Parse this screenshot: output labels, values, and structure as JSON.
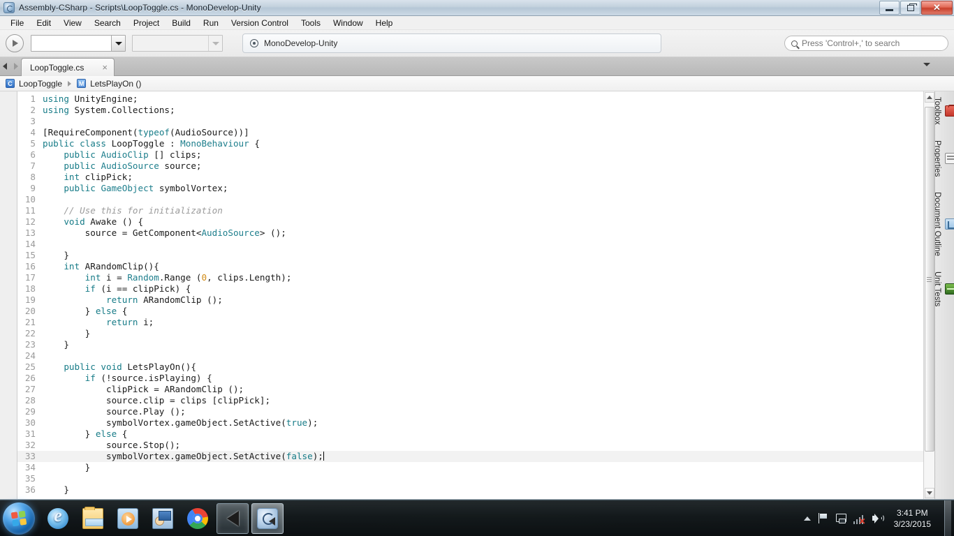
{
  "window": {
    "title": "Assembly-CSharp - Scripts\\LoopToggle.cs - MonoDevelop-Unity",
    "icon": "monodevelop-icon",
    "minimize_label": "Minimize",
    "maximize_label": "Restore",
    "close_label": "✕"
  },
  "menubar": {
    "items": [
      {
        "label": "File"
      },
      {
        "label": "Edit"
      },
      {
        "label": "View"
      },
      {
        "label": "Search"
      },
      {
        "label": "Project"
      },
      {
        "label": "Build"
      },
      {
        "label": "Run"
      },
      {
        "label": "Version Control"
      },
      {
        "label": "Tools"
      },
      {
        "label": "Window"
      },
      {
        "label": "Help"
      }
    ]
  },
  "toolbar": {
    "run_button": "run-button",
    "configuration_combo": {
      "value": "",
      "enabled": true
    },
    "target_combo": {
      "value": "",
      "enabled": false
    },
    "status_panel": {
      "icon": "target-icon",
      "text": "MonoDevelop-Unity"
    },
    "search": {
      "placeholder": "Press 'Control+,' to search",
      "value": ""
    }
  },
  "tabbar": {
    "nav_back": "◀",
    "nav_forward": "▶",
    "tabs": [
      {
        "label": "LoopToggle.cs",
        "close": "×",
        "active": true
      }
    ],
    "menu_icon": "chevron-down-icon"
  },
  "breadcrumb": {
    "class_icon_letter": "C",
    "class_name": "LoopToggle",
    "separator": "▶",
    "member_icon_letter": "M",
    "member_name": "LetsPlayOn ()"
  },
  "editor": {
    "current_line": 33,
    "colors": {
      "keyword": "#167b87",
      "type": "#1d7e8c",
      "comment": "#9b9b9b",
      "number": "#d18b16",
      "text": "#1a1a1a",
      "background": "#ffffff",
      "current_line_bg": "#f2f2f2",
      "line_number": "#9a9a9a"
    },
    "lines": [
      {
        "n": 1,
        "tokens": [
          {
            "t": "k",
            "s": "using"
          },
          {
            "t": "p",
            "s": " UnityEngine;"
          }
        ]
      },
      {
        "n": 2,
        "tokens": [
          {
            "t": "k",
            "s": "using"
          },
          {
            "t": "p",
            "s": " System.Collections;"
          }
        ]
      },
      {
        "n": 3,
        "tokens": []
      },
      {
        "n": 4,
        "tokens": [
          {
            "t": "p",
            "s": "[RequireComponent("
          },
          {
            "t": "k",
            "s": "typeof"
          },
          {
            "t": "p",
            "s": "(AudioSource))]"
          }
        ]
      },
      {
        "n": 5,
        "tokens": [
          {
            "t": "k",
            "s": "public class"
          },
          {
            "t": "p",
            "s": " LoopToggle : "
          },
          {
            "t": "t",
            "s": "MonoBehaviour"
          },
          {
            "t": "p",
            "s": " {"
          }
        ]
      },
      {
        "n": 6,
        "tokens": [
          {
            "t": "p",
            "s": "    "
          },
          {
            "t": "k",
            "s": "public"
          },
          {
            "t": "p",
            "s": " "
          },
          {
            "t": "t",
            "s": "AudioClip"
          },
          {
            "t": "p",
            "s": " [] clips;"
          }
        ]
      },
      {
        "n": 7,
        "tokens": [
          {
            "t": "p",
            "s": "    "
          },
          {
            "t": "k",
            "s": "public"
          },
          {
            "t": "p",
            "s": " "
          },
          {
            "t": "t",
            "s": "AudioSource"
          },
          {
            "t": "p",
            "s": " source;"
          }
        ]
      },
      {
        "n": 8,
        "tokens": [
          {
            "t": "p",
            "s": "    "
          },
          {
            "t": "k",
            "s": "int"
          },
          {
            "t": "p",
            "s": " clipPick;"
          }
        ]
      },
      {
        "n": 9,
        "tokens": [
          {
            "t": "p",
            "s": "    "
          },
          {
            "t": "k",
            "s": "public"
          },
          {
            "t": "p",
            "s": " "
          },
          {
            "t": "t",
            "s": "GameObject"
          },
          {
            "t": "p",
            "s": " symbolVortex;"
          }
        ]
      },
      {
        "n": 10,
        "tokens": []
      },
      {
        "n": 11,
        "tokens": [
          {
            "t": "p",
            "s": "    "
          },
          {
            "t": "c",
            "s": "// Use this for initialization"
          }
        ]
      },
      {
        "n": 12,
        "tokens": [
          {
            "t": "p",
            "s": "    "
          },
          {
            "t": "k",
            "s": "void"
          },
          {
            "t": "p",
            "s": " Awake () {"
          }
        ]
      },
      {
        "n": 13,
        "tokens": [
          {
            "t": "p",
            "s": "        source = GetComponent<"
          },
          {
            "t": "t",
            "s": "AudioSource"
          },
          {
            "t": "p",
            "s": "> ();"
          }
        ]
      },
      {
        "n": 14,
        "tokens": []
      },
      {
        "n": 15,
        "tokens": [
          {
            "t": "p",
            "s": "    }"
          }
        ]
      },
      {
        "n": 16,
        "tokens": [
          {
            "t": "p",
            "s": "    "
          },
          {
            "t": "k",
            "s": "int"
          },
          {
            "t": "p",
            "s": " ARandomClip(){"
          }
        ]
      },
      {
        "n": 17,
        "tokens": [
          {
            "t": "p",
            "s": "        "
          },
          {
            "t": "k",
            "s": "int"
          },
          {
            "t": "p",
            "s": " i = "
          },
          {
            "t": "t",
            "s": "Random"
          },
          {
            "t": "p",
            "s": ".Range ("
          },
          {
            "t": "n",
            "s": "0"
          },
          {
            "t": "p",
            "s": ", clips.Length);"
          }
        ]
      },
      {
        "n": 18,
        "tokens": [
          {
            "t": "p",
            "s": "        "
          },
          {
            "t": "k",
            "s": "if"
          },
          {
            "t": "p",
            "s": " (i == clipPick) {"
          }
        ]
      },
      {
        "n": 19,
        "tokens": [
          {
            "t": "p",
            "s": "            "
          },
          {
            "t": "k",
            "s": "return"
          },
          {
            "t": "p",
            "s": " ARandomClip ();"
          }
        ]
      },
      {
        "n": 20,
        "tokens": [
          {
            "t": "p",
            "s": "        } "
          },
          {
            "t": "k",
            "s": "else"
          },
          {
            "t": "p",
            "s": " {"
          }
        ]
      },
      {
        "n": 21,
        "tokens": [
          {
            "t": "p",
            "s": "            "
          },
          {
            "t": "k",
            "s": "return"
          },
          {
            "t": "p",
            "s": " i;"
          }
        ]
      },
      {
        "n": 22,
        "tokens": [
          {
            "t": "p",
            "s": "        }"
          }
        ]
      },
      {
        "n": 23,
        "tokens": [
          {
            "t": "p",
            "s": "    }"
          }
        ]
      },
      {
        "n": 24,
        "tokens": []
      },
      {
        "n": 25,
        "tokens": [
          {
            "t": "p",
            "s": "    "
          },
          {
            "t": "k",
            "s": "public void"
          },
          {
            "t": "p",
            "s": " LetsPlayOn(){"
          }
        ]
      },
      {
        "n": 26,
        "tokens": [
          {
            "t": "p",
            "s": "        "
          },
          {
            "t": "k",
            "s": "if"
          },
          {
            "t": "p",
            "s": " (!source.isPlaying) {"
          }
        ]
      },
      {
        "n": 27,
        "tokens": [
          {
            "t": "p",
            "s": "            clipPick = ARandomClip ();"
          }
        ]
      },
      {
        "n": 28,
        "tokens": [
          {
            "t": "p",
            "s": "            source.clip = clips [clipPick];"
          }
        ]
      },
      {
        "n": 29,
        "tokens": [
          {
            "t": "p",
            "s": "            source.Play ();"
          }
        ]
      },
      {
        "n": 30,
        "tokens": [
          {
            "t": "p",
            "s": "            symbolVortex.gameObject.SetActive("
          },
          {
            "t": "k",
            "s": "true"
          },
          {
            "t": "p",
            "s": ");"
          }
        ]
      },
      {
        "n": 31,
        "tokens": [
          {
            "t": "p",
            "s": "        } "
          },
          {
            "t": "k",
            "s": "else"
          },
          {
            "t": "p",
            "s": " {"
          }
        ]
      },
      {
        "n": 32,
        "tokens": [
          {
            "t": "p",
            "s": "            source.Stop();"
          }
        ]
      },
      {
        "n": 33,
        "tokens": [
          {
            "t": "p",
            "s": "            symbolVortex.gameObject.SetActive("
          },
          {
            "t": "k",
            "s": "false"
          },
          {
            "t": "p",
            "s": ");"
          }
        ],
        "caret": true
      },
      {
        "n": 34,
        "tokens": [
          {
            "t": "p",
            "s": "        }"
          }
        ]
      },
      {
        "n": 35,
        "tokens": []
      },
      {
        "n": 36,
        "tokens": [
          {
            "t": "p",
            "s": "    }"
          }
        ]
      }
    ]
  },
  "rail": {
    "items": [
      {
        "label": "Toolbox",
        "icon": "toolbox-icon"
      },
      {
        "label": "Properties",
        "icon": "properties-icon"
      },
      {
        "label": "Document Outline",
        "icon": "document-outline-icon"
      },
      {
        "label": "Unit Tests",
        "icon": "unit-tests-icon"
      }
    ]
  },
  "taskbar": {
    "start_label": "Start",
    "items": [
      {
        "name": "internet-explorer",
        "icon": "ie",
        "state": "pinned"
      },
      {
        "name": "windows-explorer",
        "icon": "folder",
        "state": "pinned"
      },
      {
        "name": "windows-media-player",
        "icon": "wmp",
        "state": "pinned"
      },
      {
        "name": "remote-desktop",
        "icon": "rdp",
        "state": "pinned"
      },
      {
        "name": "google-chrome",
        "icon": "chrome",
        "state": "pinned"
      },
      {
        "name": "unity",
        "icon": "unity",
        "state": "running"
      },
      {
        "name": "monodevelop",
        "icon": "mono",
        "state": "active"
      }
    ],
    "tray": {
      "show_hidden": "show-hidden-icons",
      "icons": [
        "action-center-flag",
        "network-monitor",
        "network-disconnected",
        "volume"
      ],
      "time": "3:41 PM",
      "date": "3/23/2015"
    }
  }
}
